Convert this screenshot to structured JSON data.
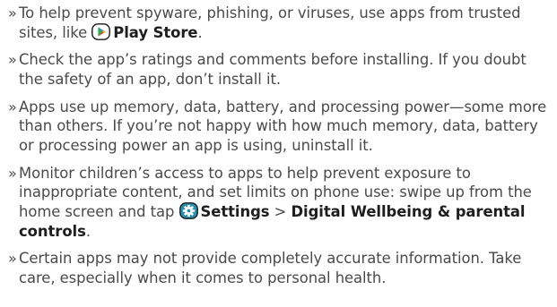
{
  "bullet": "»",
  "items": [
    {
      "text_before": "To help prevent spyware, phishing, or viruses, use apps from trusted sites, like ",
      "link_label": "Play Store",
      "text_after": "."
    },
    {
      "text": "Check the app’s ratings and comments before installing. If you doubt the safety of an app, don’t install it."
    },
    {
      "text": "Apps use up memory, data, battery, and processing power—some more than others. If you’re not happy with how much memory, data, battery or processing power an app is using, uninstall it."
    },
    {
      "text_before": "Monitor children’s access to apps to help prevent exposure to inappropriate content, and set limits on phone use: swipe up from the home screen and tap ",
      "settings_label": "Settings",
      "separator": " > ",
      "wellbeing_label": "Digital Wellbeing & parental controls",
      "text_after": "."
    },
    {
      "text": "Certain apps may not provide completely accurate information. Take care, especially when it comes to personal health."
    }
  ],
  "icons": {
    "play_store": "play-store-icon",
    "settings": "settings-gear-icon"
  },
  "colors": {
    "text": "#4a4a4a",
    "bold_text": "#1e1e1e",
    "icon_border": "#1a1a1a",
    "settings_bg": "#2b8fb0"
  }
}
